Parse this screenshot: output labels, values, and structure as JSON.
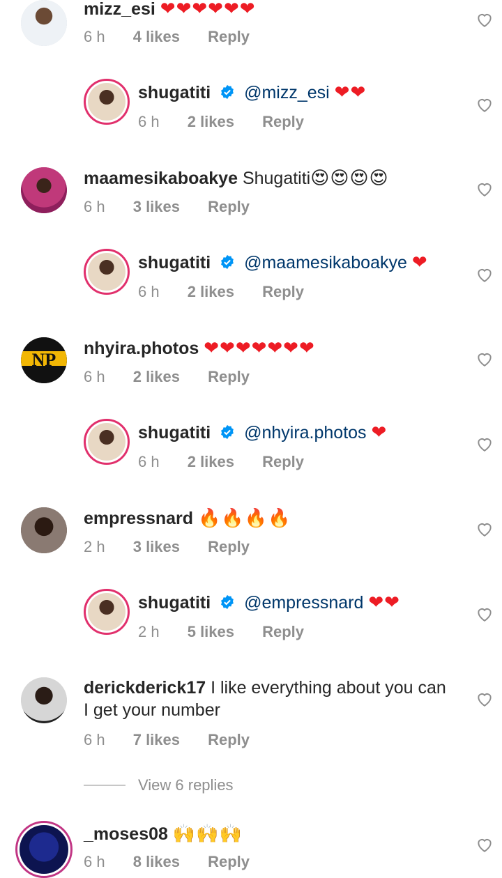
{
  "colors": {
    "accent": "#0095f6",
    "mention": "#00376b",
    "muted": "#8e8e8e",
    "heart": "#ed1c24",
    "ring": "#e1306c"
  },
  "comments": [
    {
      "user": "mizz_esi",
      "text": "",
      "emoji": "❤❤❤❤❤❤",
      "time": "6 h",
      "likes": "4 likes",
      "reply": "Reply"
    },
    {
      "user": "shugatiti",
      "verified": true,
      "mention": "@mizz_esi",
      "emoji": "❤❤",
      "time": "6 h",
      "likes": "2 likes",
      "reply": "Reply"
    },
    {
      "user": "maamesikaboakye",
      "text": "Shugatiti",
      "emoji": "😍😍😍😍",
      "time": "6 h",
      "likes": "3 likes",
      "reply": "Reply"
    },
    {
      "user": "shugatiti",
      "verified": true,
      "mention": "@maamesikaboakye",
      "emoji": "❤",
      "time": "6 h",
      "likes": "2 likes",
      "reply": "Reply"
    },
    {
      "user": "nhyira.photos",
      "text": "",
      "emoji": "❤❤❤❤❤❤❤",
      "time": "6 h",
      "likes": "2 likes",
      "reply": "Reply",
      "avatar_text": "NP"
    },
    {
      "user": "shugatiti",
      "verified": true,
      "mention": "@nhyira.photos",
      "emoji": "❤",
      "time": "6 h",
      "likes": "2 likes",
      "reply": "Reply"
    },
    {
      "user": "empressnard",
      "text": "",
      "emoji": "🔥🔥🔥🔥",
      "time": "2 h",
      "likes": "3 likes",
      "reply": "Reply"
    },
    {
      "user": "shugatiti",
      "verified": true,
      "mention": "@empressnard",
      "emoji": "❤❤",
      "time": "2 h",
      "likes": "5 likes",
      "reply": "Reply"
    },
    {
      "user": "derickderick17",
      "text": "I like everything about you can I get your number",
      "time": "6 h",
      "likes": "7 likes",
      "reply": "Reply"
    },
    {
      "user": "_moses08",
      "text": "",
      "emoji": "🙌🙌🙌",
      "time": "6 h",
      "likes": "8 likes",
      "reply": "Reply"
    }
  ],
  "view_replies": "View 6 replies"
}
